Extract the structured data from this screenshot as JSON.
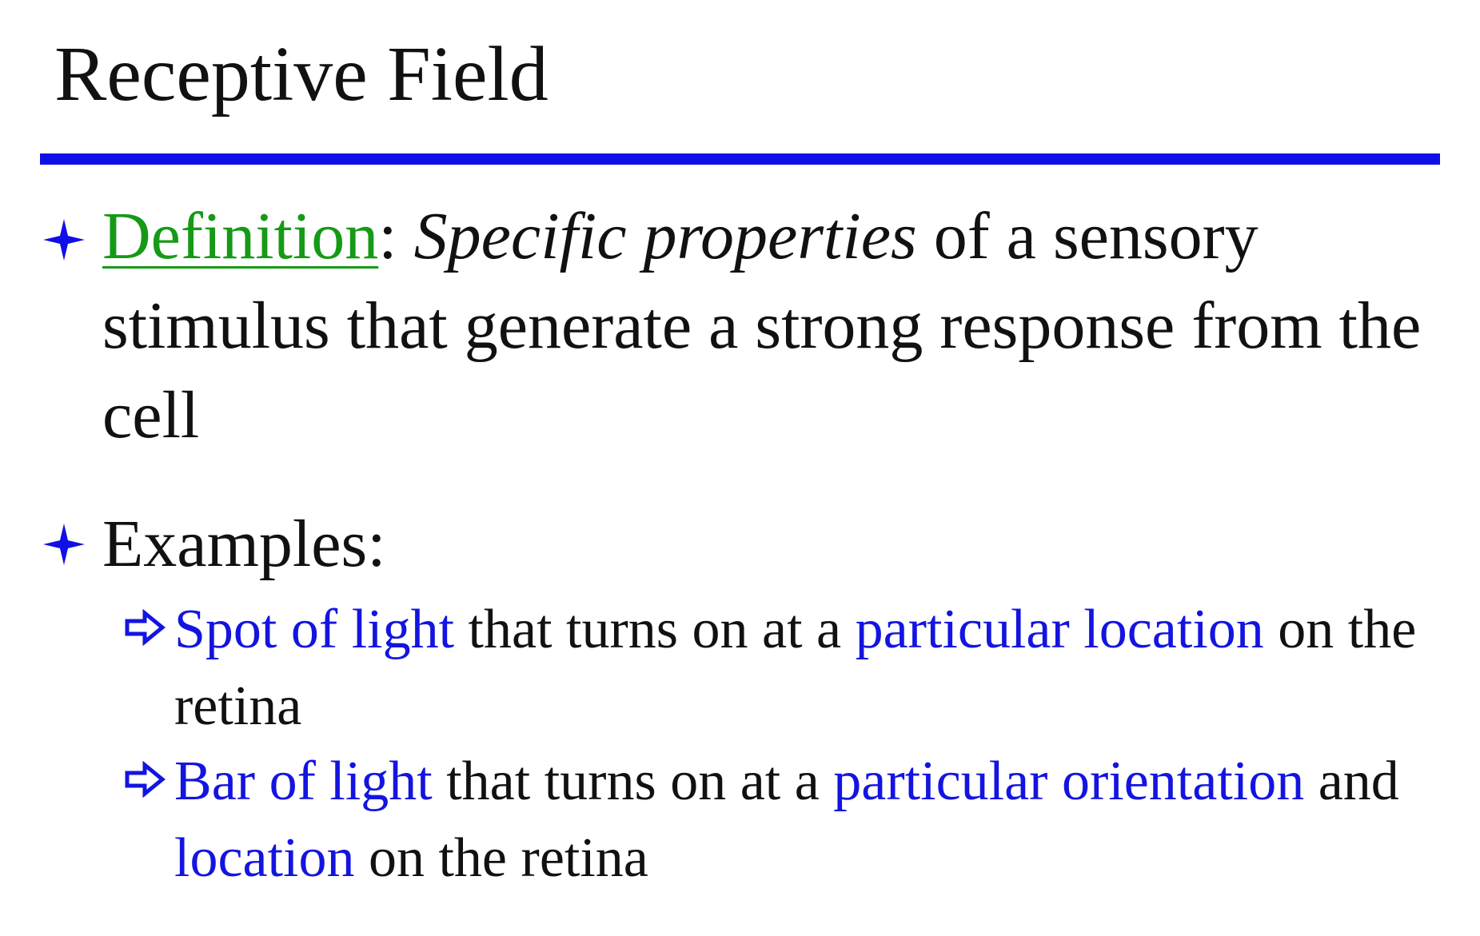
{
  "colors": {
    "title_rule": "#1010e6",
    "bullet_diamond": "#1010e6",
    "definition_term": "#169a16",
    "highlight": "#1414e0",
    "arrow": "#1414e0",
    "text": "#111111"
  },
  "slide": {
    "title": "Receptive Field",
    "bullets": [
      {
        "term": "Definition",
        "separator": ": ",
        "italic": "Specific properties",
        "rest": " of a sensory stimulus that generate a strong response from the cell"
      },
      {
        "label": "Examples:"
      }
    ],
    "examples": [
      {
        "parts": [
          {
            "text": "Spot of light",
            "highlight": true
          },
          {
            "text": " that turns on at a ",
            "highlight": false
          },
          {
            "text": "particular location",
            "highlight": true
          },
          {
            "text": " on the retina",
            "highlight": false
          }
        ]
      },
      {
        "parts": [
          {
            "text": "Bar of light",
            "highlight": true
          },
          {
            "text": " that turns on at a ",
            "highlight": false
          },
          {
            "text": "particular orientation",
            "highlight": true
          },
          {
            "text": " and ",
            "highlight": false
          },
          {
            "text": "location",
            "highlight": true
          },
          {
            "text": " on the retina",
            "highlight": false
          }
        ]
      }
    ]
  }
}
